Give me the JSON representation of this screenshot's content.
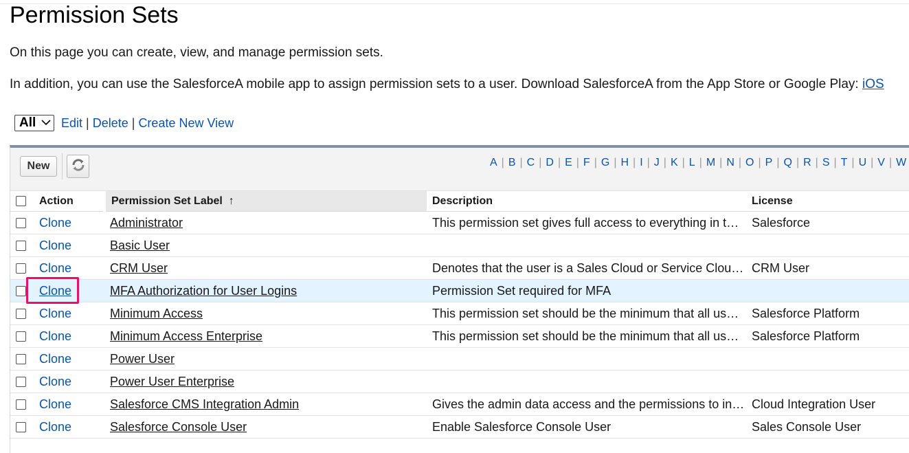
{
  "page": {
    "title": "Permission Sets",
    "intro": "On this page you can create, view, and manage permission sets.",
    "intro2_text": "In addition, you can use the SalesforceA mobile app to assign permission sets to a user. Download SalesforceA from the App Store or Google Play: ",
    "intro2_link": "iOS"
  },
  "view": {
    "selected": "All",
    "edit": "Edit",
    "delete": "Delete",
    "create": "Create New View",
    "separator": "|"
  },
  "toolbar": {
    "new_label": "New",
    "refresh_icon": "refresh-icon",
    "alpha": [
      "A",
      "B",
      "C",
      "D",
      "E",
      "F",
      "G",
      "H",
      "I",
      "J",
      "K",
      "L",
      "M",
      "N",
      "O",
      "P",
      "Q",
      "R",
      "S",
      "T",
      "U",
      "V",
      "W"
    ]
  },
  "table": {
    "columns": {
      "action": "Action",
      "label": "Permission Set Label",
      "label_sort": "↑",
      "description": "Description",
      "license": "License"
    },
    "rows": [
      {
        "action": "Clone",
        "label": "Administrator",
        "description": "This permission set gives full access to everything in t…",
        "license": "Salesforce"
      },
      {
        "action": "Clone",
        "label": "Basic User",
        "description": "",
        "license": ""
      },
      {
        "action": "Clone",
        "label": "CRM User",
        "description": "Denotes that the user is a Sales Cloud or Service Clou…",
        "license": "CRM User"
      },
      {
        "action": "Clone",
        "label": "MFA Authorization for User Logins",
        "description": "Permission Set required for MFA",
        "license": ""
      },
      {
        "action": "Clone",
        "label": "Minimum Access",
        "description": "This permission set should be the minimum that all us…",
        "license": "Salesforce Platform"
      },
      {
        "action": "Clone",
        "label": "Minimum Access Enterprise",
        "description": "This permission set should be the minimum that all us…",
        "license": "Salesforce Platform"
      },
      {
        "action": "Clone",
        "label": "Power User",
        "description": "",
        "license": ""
      },
      {
        "action": "Clone",
        "label": "Power User Enterprise",
        "description": "",
        "license": ""
      },
      {
        "action": "Clone",
        "label": "Salesforce CMS Integration Admin",
        "description": "Gives the admin data access and the permissions to in…",
        "license": "Cloud Integration User"
      },
      {
        "action": "Clone",
        "label": "Salesforce Console User",
        "description": "Enable Salesforce Console User",
        "license": "Sales Console User"
      }
    ]
  },
  "colors": {
    "link": "#0a53a8",
    "highlight_row": "#e3f3ff",
    "focus_box": "#e5126b",
    "panel_top_border": "#8190a5"
  }
}
